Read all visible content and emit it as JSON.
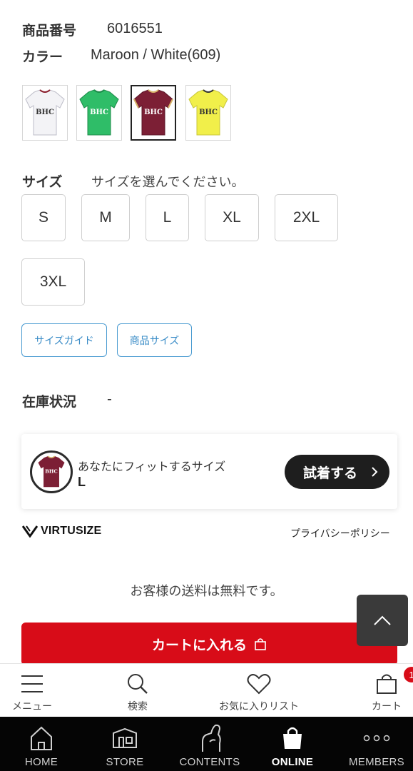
{
  "product": {
    "number_label": "商品番号",
    "number_value": "6016551",
    "color_label": "カラー",
    "color_value": "Maroon / White(609)"
  },
  "swatches": [
    {
      "name": "white",
      "color": "#f3f3f6",
      "accent": "#8a1c2b",
      "sponsor": "BHC"
    },
    {
      "name": "green",
      "color": "#2fbd68",
      "accent": "#1d8a49",
      "sponsor": "BHC"
    },
    {
      "name": "maroon",
      "color": "#7c1f35",
      "accent": "#d9b66a",
      "sponsor": "BHC"
    },
    {
      "name": "yellow",
      "color": "#f1ef4a",
      "accent": "#333333",
      "sponsor": "BHC"
    }
  ],
  "size": {
    "label": "サイズ",
    "prompt": "サイズを選んでください。",
    "options": [
      "S",
      "M",
      "L",
      "XL",
      "2XL",
      "3XL"
    ],
    "size_guide": "サイズガイド",
    "product_size": "商品サイズ"
  },
  "stock": {
    "label": "在庫状況",
    "value": "-"
  },
  "virtusize": {
    "fit_text": "あなたにフィットするサイズ",
    "fit_size": "L",
    "try_on": "試着する",
    "brand": "VIRTUSIZE",
    "privacy": "プライバシーポリシー"
  },
  "shipping_note": "お客様の送料は無料です。",
  "cart_button": "カートに入れる",
  "actionbar": {
    "menu": "メニュー",
    "search": "検索",
    "favorites": "お気に入りリスト",
    "cart": "カート",
    "cart_badge": "1"
  },
  "tabbar": {
    "home": "HOME",
    "store": "STORE",
    "contents": "CONTENTS",
    "online": "ONLINE",
    "members": "MEMBERS"
  },
  "colors": {
    "accent_red": "#d80c18",
    "guide_blue": "#3a8cc7",
    "tabbar_bg": "#050505"
  }
}
